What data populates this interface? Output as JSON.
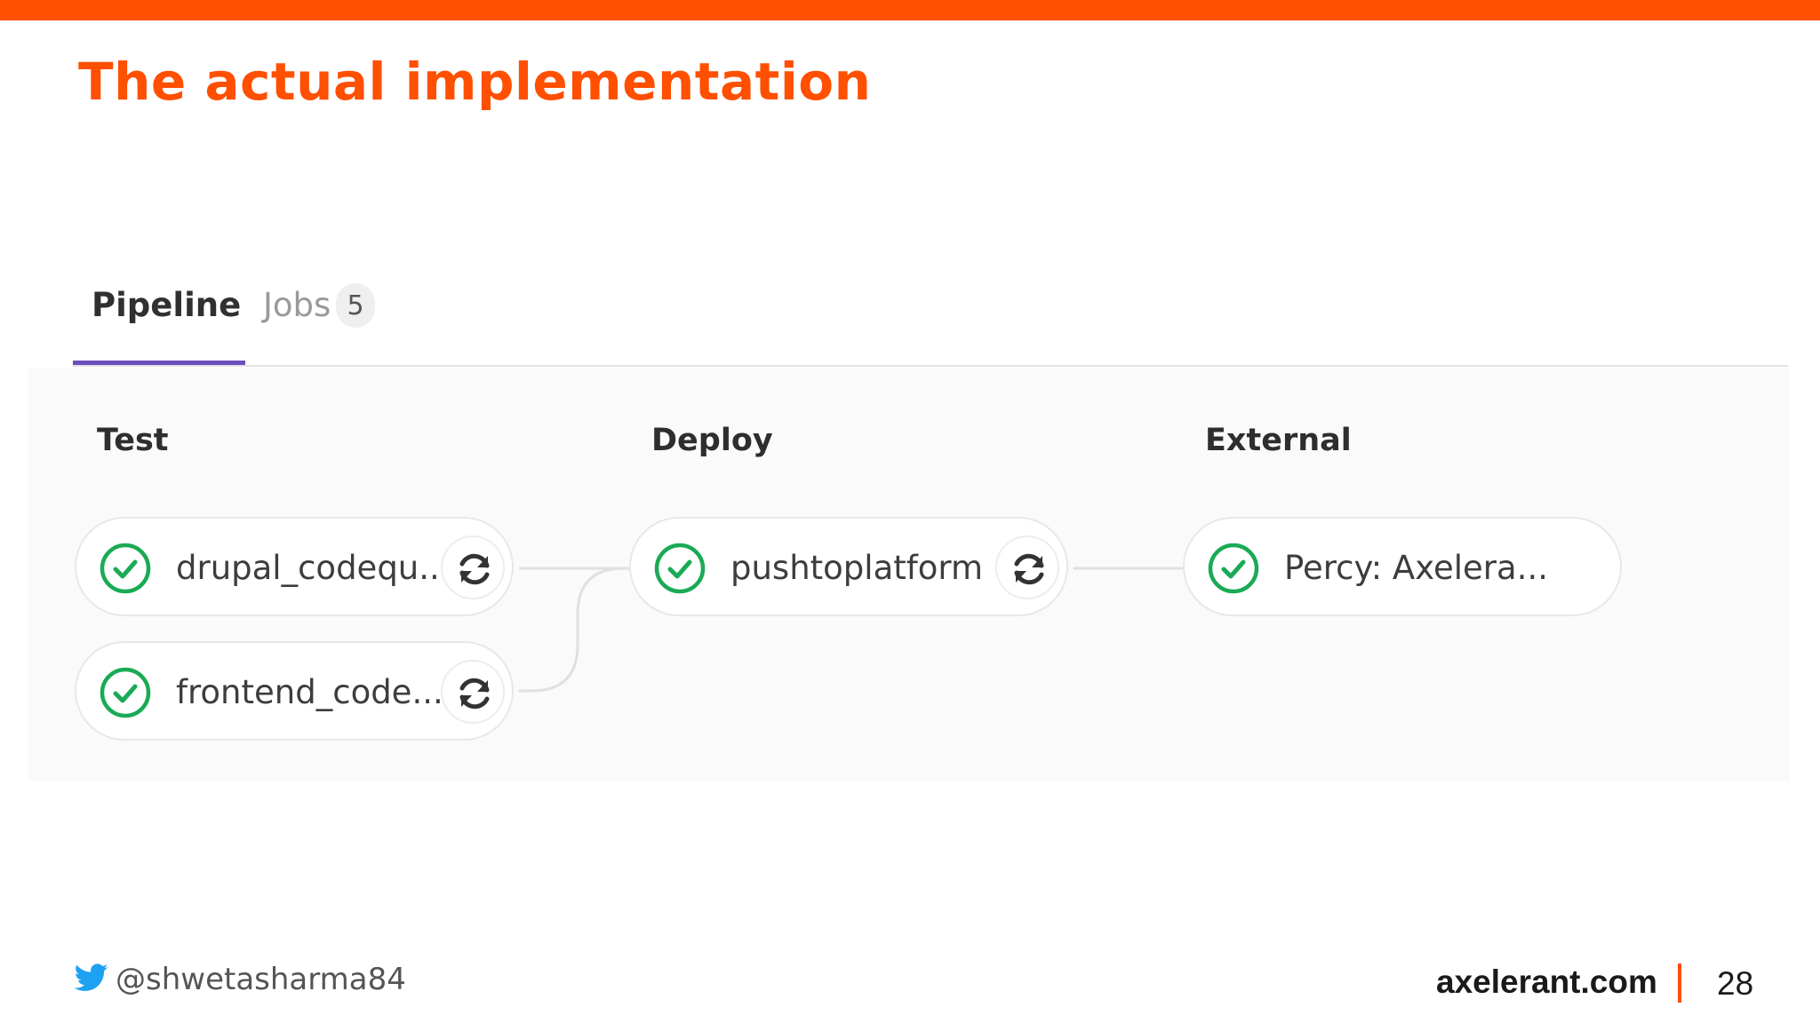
{
  "slide": {
    "title": "The actual implementation",
    "accent_color": "#ff4f00"
  },
  "tabs": {
    "pipeline_label": "Pipeline",
    "jobs_label": "Jobs",
    "jobs_count": "5",
    "active_tab": "Pipeline",
    "active_underline_color": "#6b4fbb"
  },
  "stages": [
    {
      "title": "Test",
      "jobs": [
        {
          "name": "drupal_codequ...",
          "status": "passed",
          "status_icon": "check-circle-icon",
          "action_icon": "retry-icon"
        },
        {
          "name": "frontend_code...",
          "status": "passed",
          "status_icon": "check-circle-icon",
          "action_icon": "retry-icon"
        }
      ]
    },
    {
      "title": "Deploy",
      "jobs": [
        {
          "name": "pushtoplatform",
          "status": "passed",
          "status_icon": "check-circle-icon",
          "action_icon": "retry-icon"
        }
      ]
    },
    {
      "title": "External",
      "jobs": [
        {
          "name": "Percy: Axelera...",
          "status": "passed",
          "status_icon": "check-circle-icon"
        }
      ]
    }
  ],
  "status_colors": {
    "passed": "#1aaa55"
  },
  "footer": {
    "twitter_icon": "twitter-bird-icon",
    "twitter_handle": "@shwetasharma84",
    "site": "axelerant.com",
    "page_number": "28"
  }
}
